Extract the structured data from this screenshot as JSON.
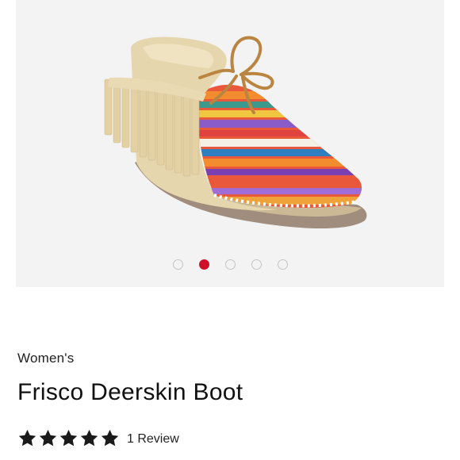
{
  "product": {
    "image_alt": "Frisco Deerskin Boot",
    "gallery": {
      "dot_count": 5,
      "active_index": 1
    },
    "category": "Women's",
    "title": "Frisco Deerskin Boot",
    "rating": {
      "stars": 5,
      "max_stars": 5
    },
    "review_label": "1 Review"
  },
  "colors": {
    "accent": "#d0102b",
    "star": "#1a1a1a",
    "dot_inactive": "#c4c4c4"
  },
  "icons": {
    "star": "star-icon"
  }
}
